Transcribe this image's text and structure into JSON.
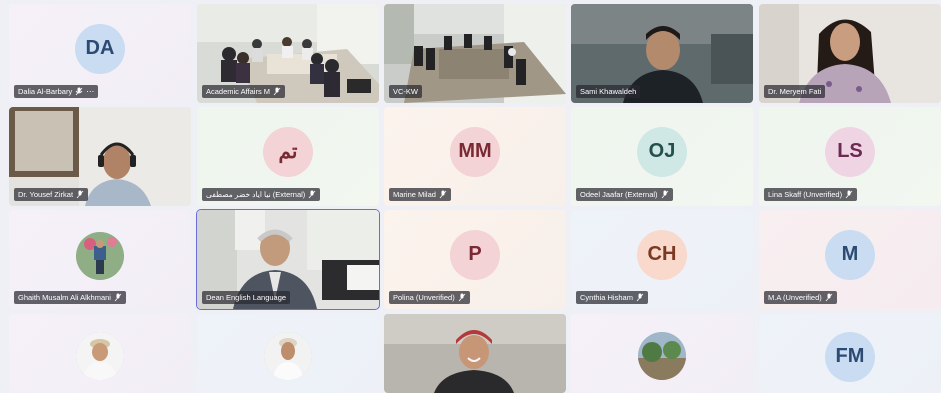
{
  "participants": [
    {
      "name": "Dalia Al-Barbary",
      "initials": "DA",
      "type": "avatar",
      "bg": "bg-lilac",
      "av": "av-blue",
      "more": "⋯"
    },
    {
      "name": "Academic Affairs M",
      "type": "video",
      "scene": "meeting-room-a"
    },
    {
      "name": "VC-KW",
      "type": "video",
      "scene": "meeting-room-b"
    },
    {
      "name": "Sami Khawaldeh",
      "type": "video",
      "scene": "person-dark"
    },
    {
      "name": "Dr. Meryem Fati",
      "type": "video",
      "scene": "person-woman"
    },
    {
      "name": "Dr. Yousef Zirkat",
      "type": "video",
      "scene": "person-headset"
    },
    {
      "name": "نيا اياد خضر مصطفى (External)",
      "initials": "تم",
      "type": "avatar",
      "bg": "bg-mint",
      "av": "av-rose"
    },
    {
      "name": "Marine Milad",
      "initials": "MM",
      "type": "avatar",
      "bg": "bg-peach",
      "av": "av-rose"
    },
    {
      "name": "Odeel Jaafar (External)",
      "initials": "OJ",
      "type": "avatar",
      "bg": "bg-mint",
      "av": "av-green"
    },
    {
      "name": "Lina Skaff (Unverified)",
      "initials": "LS",
      "type": "avatar",
      "bg": "bg-mint",
      "av": "av-pink"
    },
    {
      "name": "Ghaith Musalm Ali Alkhmani",
      "type": "photo",
      "bg": "bg-lilac"
    },
    {
      "name": "Dean English Language",
      "type": "video",
      "scene": "person-office",
      "active": true
    },
    {
      "name": "Polina (Unverified)",
      "initials": "P",
      "type": "avatar",
      "bg": "bg-peach",
      "av": "av-rose"
    },
    {
      "name": "Cynthia Hisham",
      "initials": "CH",
      "type": "avatar",
      "bg": "bg-sky",
      "av": "av-peach"
    },
    {
      "name": "M.A (Unverified)",
      "initials": "M",
      "type": "avatar",
      "bg": "bg-rose",
      "av": "av-blue"
    },
    {
      "type": "photo",
      "bg": "bg-lilac"
    },
    {
      "type": "photo",
      "bg": "bg-sky"
    },
    {
      "type": "video",
      "scene": "person-hat"
    },
    {
      "type": "photo",
      "bg": "bg-lilac"
    },
    {
      "initials": "FM",
      "type": "avatar",
      "bg": "bg-sky",
      "av": "av-blue"
    }
  ],
  "colors": {
    "active_outline": "#6e6ad8",
    "label_bg": "rgba(40,40,48,0.72)"
  }
}
